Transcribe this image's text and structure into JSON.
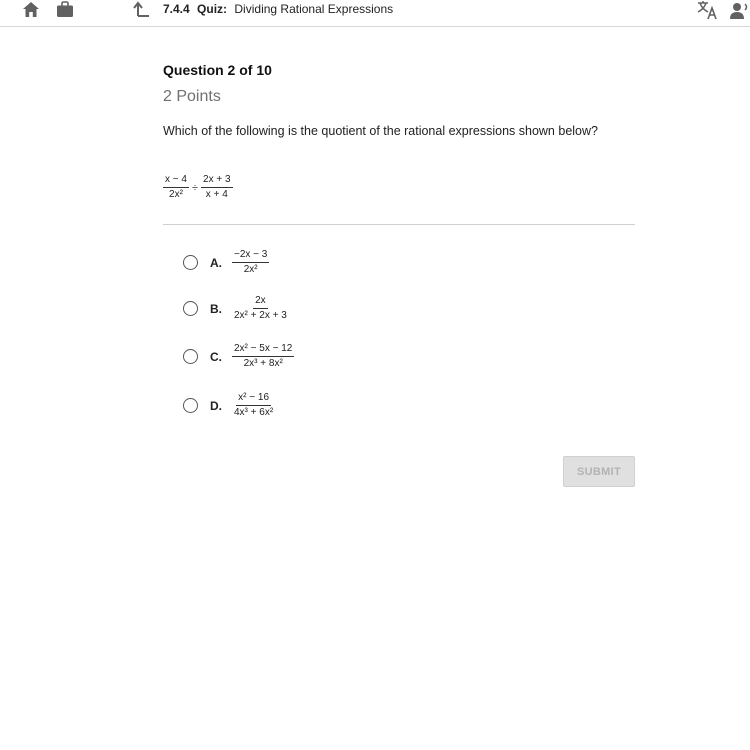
{
  "header": {
    "icons": [
      "home-icon",
      "briefcase-icon",
      "back-icon",
      "translate-icon",
      "speaker-icon"
    ],
    "lesson_code": "7.4.4",
    "quiz_label": "Quiz:",
    "title": "Dividing Rational Expressions"
  },
  "question": {
    "heading": "Question 2 of 10",
    "points": "2 Points",
    "text": "Which of the following is the quotient of the rational expressions shown below?",
    "expression": {
      "left": {
        "num": "x − 4",
        "den": "2x²"
      },
      "operator": "÷",
      "right": {
        "num": "2x + 3",
        "den": "x + 4"
      }
    }
  },
  "options": [
    {
      "letter": "A.",
      "num": "−2x − 3",
      "den": "2x²"
    },
    {
      "letter": "B.",
      "num": "2x",
      "den": "2x² + 2x + 3"
    },
    {
      "letter": "C.",
      "num": "2x² − 5x − 12",
      "den": "2x³ + 8x²"
    },
    {
      "letter": "D.",
      "num": "x² − 16",
      "den": "4x³ + 6x²"
    }
  ],
  "submit_label": "SUBMIT",
  "colors": {
    "text": "#222222",
    "muted": "#707070",
    "divider": "#cfcfcf",
    "submit_bg": "#e0e0e0",
    "submit_text": "#b3b3b3"
  }
}
